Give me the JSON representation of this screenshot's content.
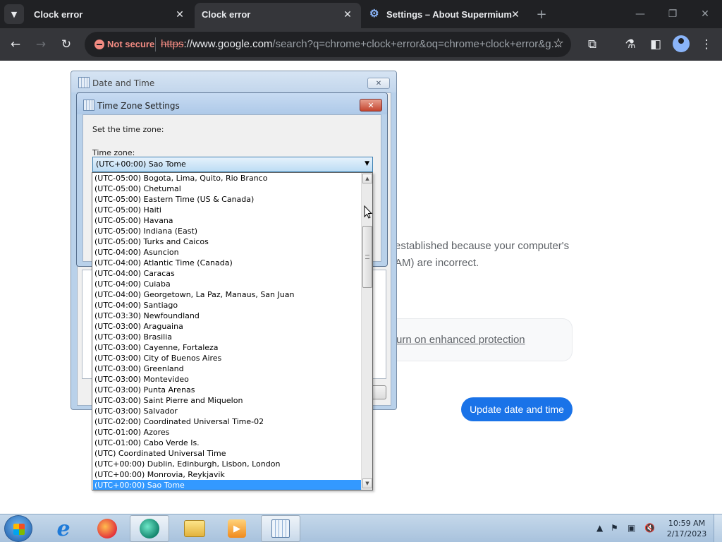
{
  "browser": {
    "tabs": [
      {
        "title": "Clock error",
        "active": false
      },
      {
        "title": "Clock error",
        "active": true
      },
      {
        "title": "Settings – About Supermium",
        "active": false
      }
    ],
    "security_label": "Not secure",
    "url_protocol": "https",
    "url_host": "://www.google.com",
    "url_rest": "/search?q=chrome+clock+error&oq=chrome+clock+error&g..."
  },
  "page": {
    "error_line1": "established because your computer's",
    "error_line2": "AM) are incorrect.",
    "protection_link": "urn on enhanced protection",
    "update_button": "Update date and time"
  },
  "date_time_dialog": {
    "title": "Date and Time"
  },
  "tz_dialog": {
    "title": "Time Zone Settings",
    "set_label": "Set the time zone:",
    "tz_label": "Time zone:",
    "selected": "(UTC+00:00) Sao Tome",
    "options": [
      "(UTC-05:00) Bogota, Lima, Quito, Rio Branco",
      "(UTC-05:00) Chetumal",
      "(UTC-05:00) Eastern Time (US & Canada)",
      "(UTC-05:00) Haiti",
      "(UTC-05:00) Havana",
      "(UTC-05:00) Indiana (East)",
      "(UTC-05:00) Turks and Caicos",
      "(UTC-04:00) Asuncion",
      "(UTC-04:00) Atlantic Time (Canada)",
      "(UTC-04:00) Caracas",
      "(UTC-04:00) Cuiaba",
      "(UTC-04:00) Georgetown, La Paz, Manaus, San Juan",
      "(UTC-04:00) Santiago",
      "(UTC-03:30) Newfoundland",
      "(UTC-03:00) Araguaina",
      "(UTC-03:00) Brasilia",
      "(UTC-03:00) Cayenne, Fortaleza",
      "(UTC-03:00) City of Buenos Aires",
      "(UTC-03:00) Greenland",
      "(UTC-03:00) Montevideo",
      "(UTC-03:00) Punta Arenas",
      "(UTC-03:00) Saint Pierre and Miquelon",
      "(UTC-03:00) Salvador",
      "(UTC-02:00) Coordinated Universal Time-02",
      "(UTC-01:00) Azores",
      "(UTC-01:00) Cabo Verde Is.",
      "(UTC) Coordinated Universal Time",
      "(UTC+00:00) Dublin, Edinburgh, Lisbon, London",
      "(UTC+00:00) Monrovia, Reykjavik",
      "(UTC+00:00) Sao Tome"
    ]
  },
  "taskbar": {
    "apps": [
      "start",
      "internet-explorer",
      "firefox",
      "supermium",
      "file-explorer",
      "media-player",
      "date-time"
    ],
    "time": "10:59 AM",
    "date": "2/17/2023"
  },
  "colors": {
    "chrome_dark": "#202124",
    "chrome_toolbar": "#35363a",
    "not_secure": "#f28b82",
    "primary_button": "#1a73e8",
    "list_selection": "#3399ff"
  }
}
